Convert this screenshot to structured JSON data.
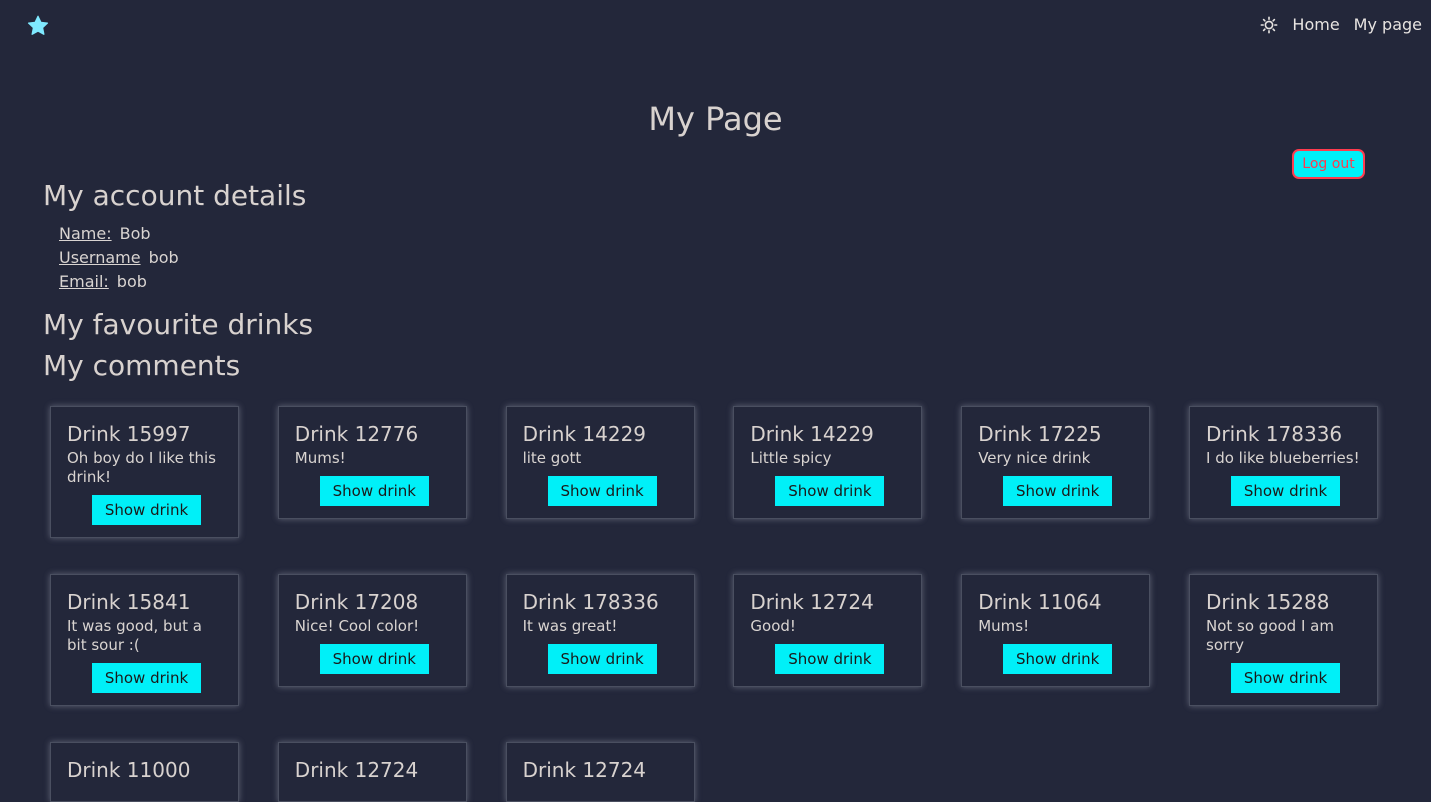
{
  "nav": {
    "home": "Home",
    "my_page": "My page"
  },
  "page": {
    "title": "My Page",
    "logout": "Log out"
  },
  "account": {
    "heading": "My account details",
    "rows": [
      {
        "label": "Name:",
        "value": "Bob"
      },
      {
        "label": "Username",
        "value": "bob"
      },
      {
        "label": "Email:",
        "value": "bob"
      }
    ]
  },
  "favourites": {
    "heading": "My favourite drinks"
  },
  "comments": {
    "heading": "My comments",
    "button_label": "Show drink",
    "items": [
      {
        "title": "Drink 15997",
        "text": "Oh boy do I like this drink!"
      },
      {
        "title": "Drink 12776",
        "text": "Mums!"
      },
      {
        "title": "Drink 14229",
        "text": "lite gott"
      },
      {
        "title": "Drink 14229",
        "text": "Little spicy"
      },
      {
        "title": "Drink 17225",
        "text": "Very nice drink"
      },
      {
        "title": "Drink 178336",
        "text": "I do like blueberries!"
      },
      {
        "title": "Drink 15841",
        "text": "It was good, but a bit sour :("
      },
      {
        "title": "Drink 17208",
        "text": "Nice! Cool color!"
      },
      {
        "title": "Drink 178336",
        "text": "It was great!"
      },
      {
        "title": "Drink 12724",
        "text": "Good!"
      },
      {
        "title": "Drink 11064",
        "text": "Mums!"
      },
      {
        "title": "Drink 15288",
        "text": "Not so good I am sorry"
      },
      {
        "title": "Drink 11000",
        "text": ""
      },
      {
        "title": "Drink 12724",
        "text": ""
      },
      {
        "title": "Drink 12724",
        "text": ""
      }
    ]
  },
  "colors": {
    "background": "#23273a",
    "accent": "#00f0f8",
    "logout_border": "#ff3b4e",
    "star": "#7fe9ff"
  },
  "icons": {
    "logo": "star-icon",
    "theme": "sun-icon"
  }
}
